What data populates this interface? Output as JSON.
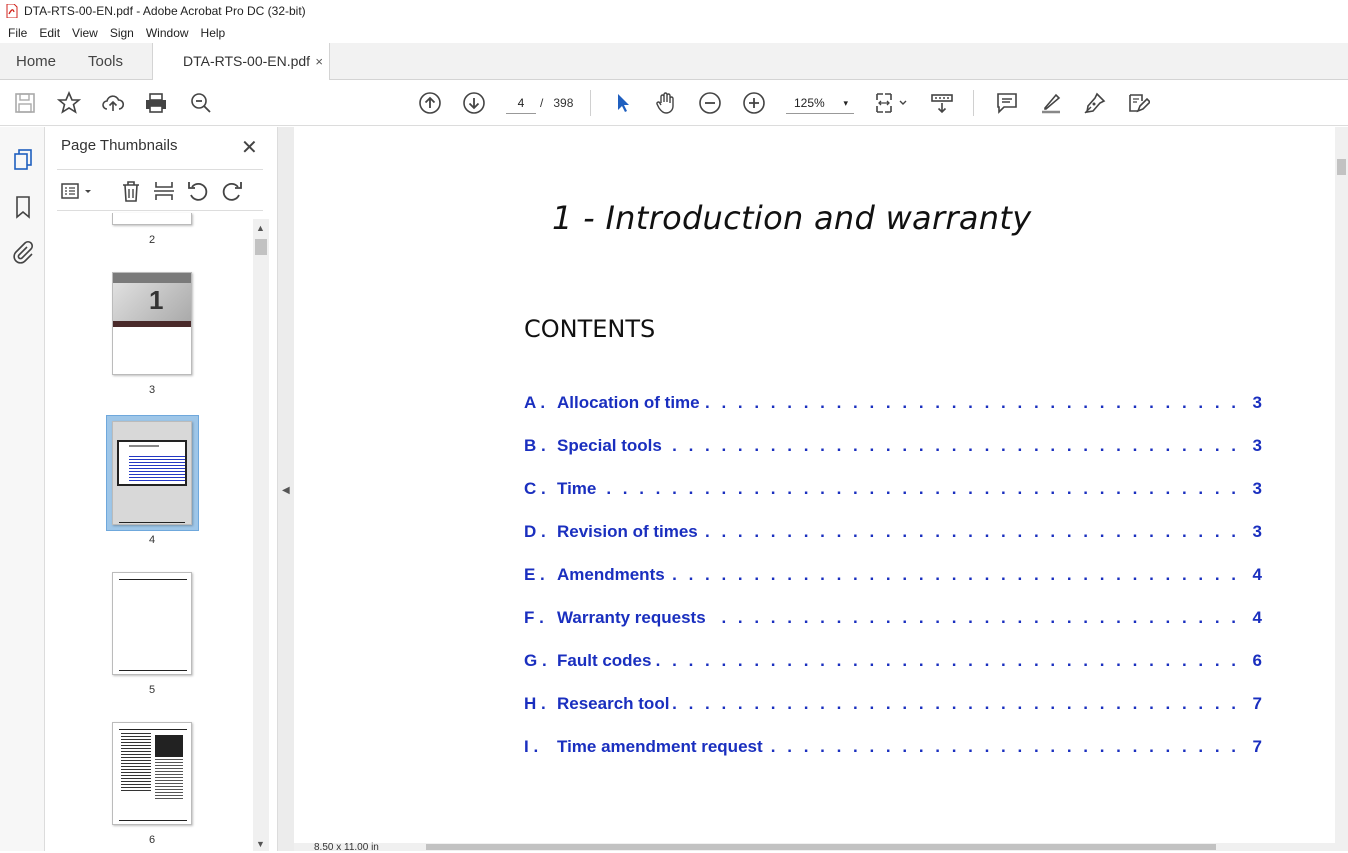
{
  "window": {
    "title": "DTA-RTS-00-EN.pdf - Adobe Acrobat Pro DC (32-bit)"
  },
  "menu": [
    "File",
    "Edit",
    "View",
    "Sign",
    "Window",
    "Help"
  ],
  "tabs": {
    "home": "Home",
    "tools": "Tools",
    "document": "DTA-RTS-00-EN.pdf",
    "close": "×"
  },
  "toolbar": {
    "current_page": "4",
    "page_separator": "/",
    "total_pages": "398",
    "zoom": "125%",
    "zoom_caret": "▾"
  },
  "thumbnails": {
    "header": "Page Thumbnails",
    "close": "✕",
    "pages": [
      "2",
      "3",
      "4",
      "5",
      "6"
    ],
    "selected_page": "4"
  },
  "document": {
    "title": "1 - Introduction and warranty",
    "contents_heading": "CONTENTS",
    "toc": [
      {
        "letter": "A .",
        "title": "Allocation of time",
        "page": "3"
      },
      {
        "letter": "B .",
        "title": "Special tools",
        "page": "3"
      },
      {
        "letter": "C .",
        "title": "Time",
        "page": "3"
      },
      {
        "letter": "D .",
        "title": "Revision of times",
        "page": "3"
      },
      {
        "letter": "E .",
        "title": "Amendments",
        "page": "4"
      },
      {
        "letter": "F .",
        "title": "Warranty requests",
        "page": "4"
      },
      {
        "letter": "G .",
        "title": "Fault codes",
        "page": "6"
      },
      {
        "letter": "H .",
        "title": "Research tool",
        "page": "7"
      },
      {
        "letter": "I .",
        "title": "Time amendment request",
        "page": "7"
      }
    ],
    "page_size": "8.50 x 11.00 in",
    "dots": ". . . . . . . . . . . . . . . . . . . . . . . . . . . . . . . . . . . . . . . . . . . . . . . . . . . . . . . . . . . . . . . . . . . . . . . . . . . . . . . . ."
  },
  "colors": {
    "link_blue": "#1a2fbf",
    "selection_blue": "#9ec6e8",
    "acrobat_red": "#d1231c"
  }
}
